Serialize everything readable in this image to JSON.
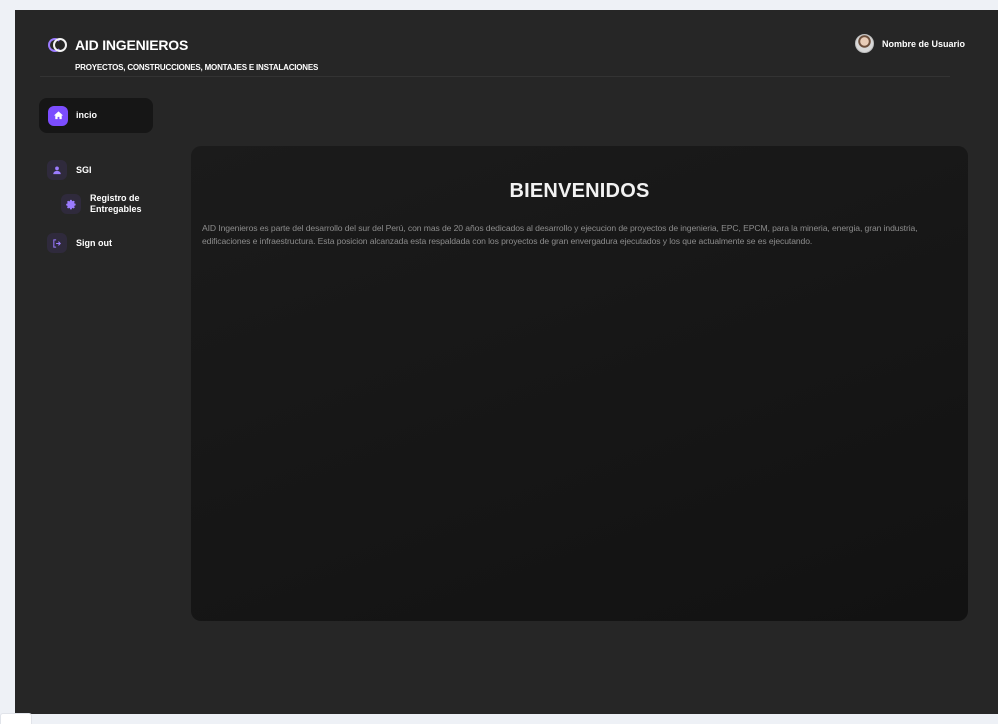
{
  "brand": {
    "title": "AID INGENIEROS",
    "subtitle": "PROYECTOS, CONSTRUCCIONES, MONTAJES E INSTALACIONES",
    "logo_icon": "aid-logo-icon"
  },
  "user": {
    "name": "Nombre de Usuario",
    "avatar_icon": "user-avatar"
  },
  "sidebar": {
    "items": [
      {
        "label": "incio",
        "icon": "home-icon",
        "active": true
      },
      {
        "label": "SGI",
        "icon": "user-icon",
        "active": false
      },
      {
        "label": "Registro de Entregables",
        "icon": "gear-icon",
        "active": false,
        "sub": true
      },
      {
        "label": "Sign out",
        "icon": "sign-out-icon",
        "active": false
      }
    ]
  },
  "main": {
    "heading": "BIENVENIDOS",
    "body": "AID Ingenieros es parte del desarrollo del sur del Perú, con mas de 20 años dedicados al desarrollo y ejecucion de proyectos de ingenieria, EPC, EPCM, para la mineria, energia, gran industria, edificaciones e infraestructura. Esta posicion alcanzada esta respaldada con los proyectos de gran envergadura ejecutados y los que actualmente se es ejecutando."
  },
  "colors": {
    "accent": "#7c4dff",
    "frame_bg": "#262626",
    "panel_bg": "#151515",
    "page_bg": "#eef1f6"
  }
}
